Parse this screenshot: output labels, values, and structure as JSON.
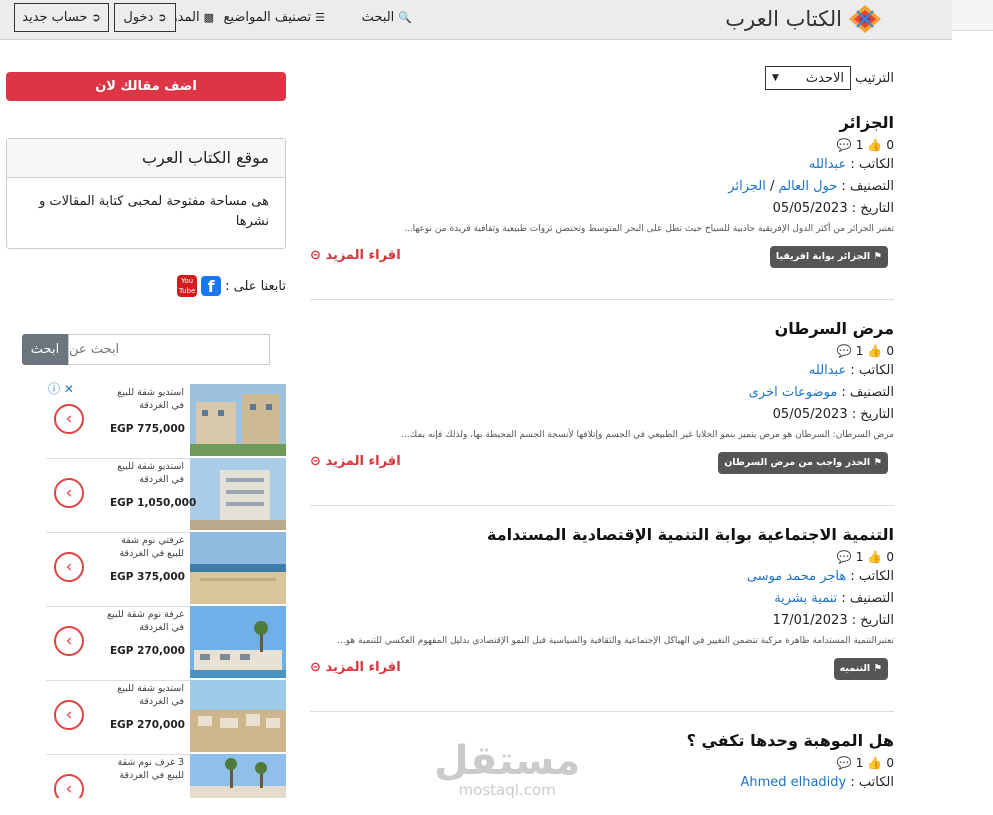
{
  "navbar": {
    "brand": "الكتاب العرب",
    "search": "البحث",
    "categories": "تصنيف المواضيع",
    "bloggers": "المدونيين",
    "login": "دخول",
    "register": "حساب جديد"
  },
  "sort": {
    "label": "الترتيب",
    "selected": "الاحدث"
  },
  "articles": [
    {
      "title": "الجزائر",
      "likes": "0",
      "comments": "1",
      "author_label": "الكاتب :",
      "author": "عبدالله",
      "category_label": "التصنيف :",
      "category_1": "حول العالم",
      "category_sep": "/",
      "category_2": "الجزائر",
      "date_label": "التاريخ :",
      "date": "05/05/2023",
      "excerpt": "تعتبر الجزائر من أكثر الدول الإفريقية جاذبية للسياح حيث تطل على البحر المتوسط وتحتضن ثروات طبيعية وثقافية فريدة من نوعها...",
      "tag": "الجزائر بوابة افريقيا",
      "read_more": "اقراء المزيد"
    },
    {
      "title": "مرض السرطان",
      "likes": "0",
      "comments": "1",
      "author_label": "الكاتب :",
      "author": "عبدالله",
      "category_label": "التصنيف :",
      "category_1": "موضوعات اخرى",
      "date_label": "التاريخ :",
      "date": "05/05/2023",
      "excerpt": "مرض السرطان: السرطان هو مرض يتميز بنمو الخلايا غير الطبيعي في الجسم وإتلافها لأنسجة الجسم المحيطة بها، ولذلك فإنه يمك...",
      "tag": "الحذر واجب من مرض السرطان",
      "read_more": "اقراء المزيد"
    },
    {
      "title": "التنمية الاجتماعية بوابة التنمية الإقتصادية المستدامة",
      "likes": "0",
      "comments": "1",
      "author_label": "الكاتب :",
      "author": "هاجر محمد موسى",
      "category_label": "التصنيف :",
      "category_1": "تنمية بشرية",
      "date_label": "التاريخ :",
      "date": "17/01/2023",
      "excerpt": "تعتبرالتنمية المستدامة ظاهرة مركبة تتضمن التغيير في الهياكل الإجتماعية والثقافية والسياسية قبل النمو الإقتصادي بدليل المفهوم العكسي للتنمية هو...",
      "tag": "التنميه",
      "read_more": "اقراء المزيد"
    },
    {
      "title": "هل الموهبة وحدها تكفي ؟",
      "likes": "0",
      "comments": "1",
      "author_label": "الكاتب :",
      "author": "Ahmed elhadidy"
    }
  ],
  "sidebar": {
    "add_article": "اضف مقالك لان",
    "about_title": "موقع الكتاب العرب",
    "about_body": "هى مساحة مفتوحة لمحبى كتابة المقالات و نشرها",
    "follow_label": "تابعنا على :",
    "facebook_glyph": "f",
    "youtube_glyph_1": "You",
    "youtube_glyph_2": "Tube",
    "search_placeholder": "ابحث عن",
    "search_button": "ابحث"
  },
  "ads": {
    "close": "ⓘ ✕",
    "items": [
      {
        "text": "استديو شقة للبيع في الغردقة",
        "price": "EGP 775,000"
      },
      {
        "text": "استديو شقة للبيع في الغردقة",
        "price": "EGP 1,050,000"
      },
      {
        "text": "غرفتي نوم شقة للبيع في الغردقة",
        "price": "EGP 375,000"
      },
      {
        "text": "غرفة نوم شقة للبيع في الغردقة",
        "price": "EGP 270,000"
      },
      {
        "text": "استديو شقة للبيع في الغردقة",
        "price": "EGP 270,000"
      },
      {
        "text": "3 غرف نوم شقة للبيع في الغردقة",
        "price": ""
      }
    ]
  },
  "watermark": {
    "arabic": "مستقل",
    "latin": "mostaql.com"
  },
  "colors": {
    "accent_red": "#dc3545",
    "link_blue": "#1a73c8",
    "tag_bg": "#555555",
    "navbar_bg": "#ececec"
  }
}
